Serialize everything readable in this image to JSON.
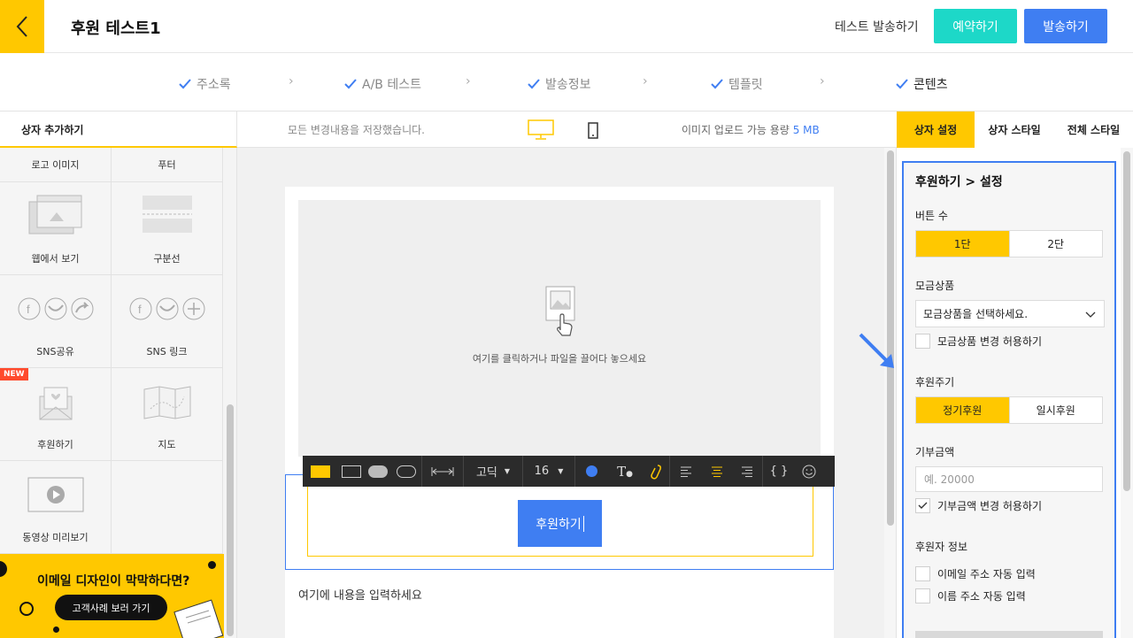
{
  "header": {
    "title": "후원 테스트1",
    "test_send": "테스트 발송하기",
    "reserve": "예약하기",
    "send": "발송하기"
  },
  "steps": [
    "주소록",
    "A/B 테스트",
    "발송정보",
    "템플릿",
    "콘텐츠"
  ],
  "left": {
    "heading": "상자 추가하기",
    "top_row": [
      "로고 이미지",
      "푸터"
    ],
    "tiles": [
      "웹에서 보기",
      "구분선",
      "SNS공유",
      "SNS 링크",
      "후원하기",
      "지도",
      "동영상 미리보기"
    ],
    "new_badge": "NEW",
    "banner_title": "이메일 디자인이 막막하다면?",
    "banner_button": "고객사례 보러 가기"
  },
  "center": {
    "saved": "모든 변경내용을 저장했습니다.",
    "upload_label": "이미지 업로드 가능 용량",
    "upload_value": "5 MB",
    "drop_hint": "여기를 클릭하거나 파일을 끌어다 놓으세요",
    "donate_button": "후원하기",
    "body_placeholder": "여기에 내용을 입력하세요",
    "font": "고딕",
    "font_size": "16"
  },
  "right": {
    "tabs": [
      "상자 설정",
      "상자 스타일",
      "전체 스타일"
    ],
    "title": "후원하기 > 설정",
    "button_count_label": "버튼 수",
    "button_count_options": [
      "1단",
      "2단"
    ],
    "product_label": "모금상품",
    "product_select": "모금상품을 선택하세요.",
    "product_allow": "모금상품 변경 허용하기",
    "cycle_label": "후원주기",
    "cycle_options": [
      "정기후원",
      "일시후원"
    ],
    "amount_label": "기부금액",
    "amount_placeholder": "예. 20000",
    "amount_allow": "기부금액 변경 허용하기",
    "donor_label": "후원자 정보",
    "donor_email": "이메일 주소 자동 입력",
    "donor_name": "이름 주소 자동 입력"
  },
  "colors": {
    "accent": "#ffc800",
    "primary_blue": "#3f7ef2",
    "teal": "#1dd8c8"
  }
}
